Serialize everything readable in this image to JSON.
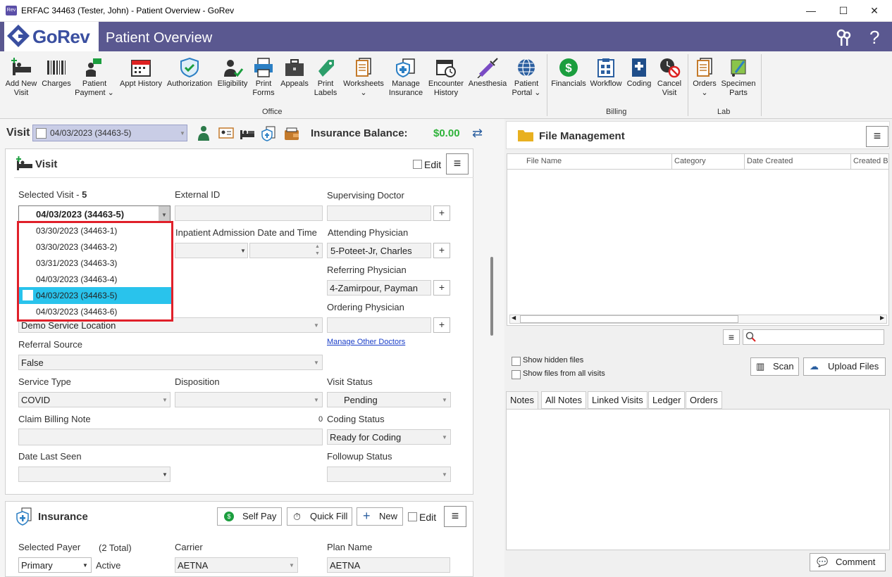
{
  "window": {
    "title": "ERFAC 34463 (Tester, John) - Patient Overview - GoRev",
    "minimize": "—",
    "maximize": "☐",
    "close": "✕"
  },
  "header": {
    "brand": "GoRev",
    "title": "Patient Overview",
    "help": "?"
  },
  "ribbon": {
    "office": [
      {
        "label1": "Add New",
        "label2": "Visit"
      },
      {
        "label1": "Charges",
        "label2": ""
      },
      {
        "label1": "Patient",
        "label2": "Payment ⌄"
      },
      {
        "label1": "Appt History",
        "label2": ""
      },
      {
        "label1": "Authorization",
        "label2": ""
      },
      {
        "label1": "Eligibility",
        "label2": ""
      },
      {
        "label1": "Print",
        "label2": "Forms"
      },
      {
        "label1": "Appeals",
        "label2": ""
      },
      {
        "label1": "Print",
        "label2": "Labels"
      },
      {
        "label1": "Worksheets",
        "label2": "⌄"
      },
      {
        "label1": "Manage",
        "label2": "Insurance"
      },
      {
        "label1": "Encounter",
        "label2": "History"
      },
      {
        "label1": "Anesthesia",
        "label2": ""
      },
      {
        "label1": "Patient",
        "label2": "Portal ⌄"
      }
    ],
    "billing": [
      {
        "label1": "Financials",
        "label2": ""
      },
      {
        "label1": "Workflow",
        "label2": ""
      },
      {
        "label1": "Coding",
        "label2": ""
      },
      {
        "label1": "Cancel",
        "label2": "Visit"
      }
    ],
    "lab": [
      {
        "label1": "Orders",
        "label2": "⌄"
      },
      {
        "label1": "Specimen",
        "label2": "Parts"
      }
    ],
    "groups": {
      "office": "Office",
      "billing": "Billing",
      "lab": "Lab"
    }
  },
  "visitbar": {
    "label": "Visit",
    "selected": "04/03/2023 (34463-5)",
    "insurance_label": "Insurance Balance:",
    "insurance_balance": "$0.00"
  },
  "visit_panel": {
    "title": "Visit",
    "edit": "Edit",
    "selected_visit_label": "Selected Visit - ",
    "selected_visit_count": "5",
    "selected_visit_value": "04/03/2023 (34463-5)",
    "dropdown_options": [
      "03/30/2023 (34463-1)",
      "03/30/2023 (34463-2)",
      "03/31/2023 (34463-3)",
      "04/03/2023 (34463-4)",
      "04/03/2023 (34463-5)",
      "04/03/2023 (34463-6)"
    ],
    "external_id_label": "External ID",
    "inpatient_label": "Inpatient Admission Date and Time",
    "supervising_label": "Supervising Doctor",
    "attending_label": "Attending Physician",
    "attending_value": "5-Poteet-Jr, Charles",
    "referring_label": "Referring Physician",
    "referring_value": "4-Zamirpour, Payman",
    "ordering_label": "Ordering Physician",
    "service_location_value": "Demo Service Location",
    "manage_doctors": "Manage Other Doctors",
    "referral_source_label": "Referral Source",
    "referral_source_value": "False",
    "service_type_label": "Service Type",
    "service_type_value": "COVID",
    "disposition_label": "Disposition",
    "visit_status_label": "Visit Status",
    "visit_status_value": "Pending",
    "claim_note_label": "Claim Billing Note",
    "claim_note_count": "0",
    "coding_status_label": "Coding Status",
    "coding_status_value": "Ready for Coding",
    "date_last_seen_label": "Date Last Seen",
    "followup_label": "Followup Status"
  },
  "insurance_panel": {
    "title": "Insurance",
    "self_pay": "Self Pay",
    "quick_fill": "Quick Fill",
    "new": "New",
    "edit": "Edit",
    "selected_payer_label": "Selected Payer",
    "total": "(2 Total)",
    "payer_value": "Primary",
    "active": "Active",
    "carrier_label": "Carrier",
    "carrier_value": "AETNA",
    "plan_label": "Plan Name",
    "plan_value": "AETNA"
  },
  "file_mgmt": {
    "title": "File Management",
    "columns": [
      "File Name",
      "Category",
      "Date Created",
      "Created B"
    ],
    "show_hidden": "Show hidden files",
    "show_all": "Show files from all visits",
    "scan": "Scan",
    "upload": "Upload Files"
  },
  "notes": {
    "tabs": [
      "Notes",
      "All Notes",
      "Linked Visits",
      "Ledger",
      "Orders"
    ],
    "comment": "Comment"
  },
  "colors": {
    "header": "#5a5890",
    "highlight": "#29c3ec",
    "red_outline": "#e0202a",
    "money": "#2fb33a"
  }
}
